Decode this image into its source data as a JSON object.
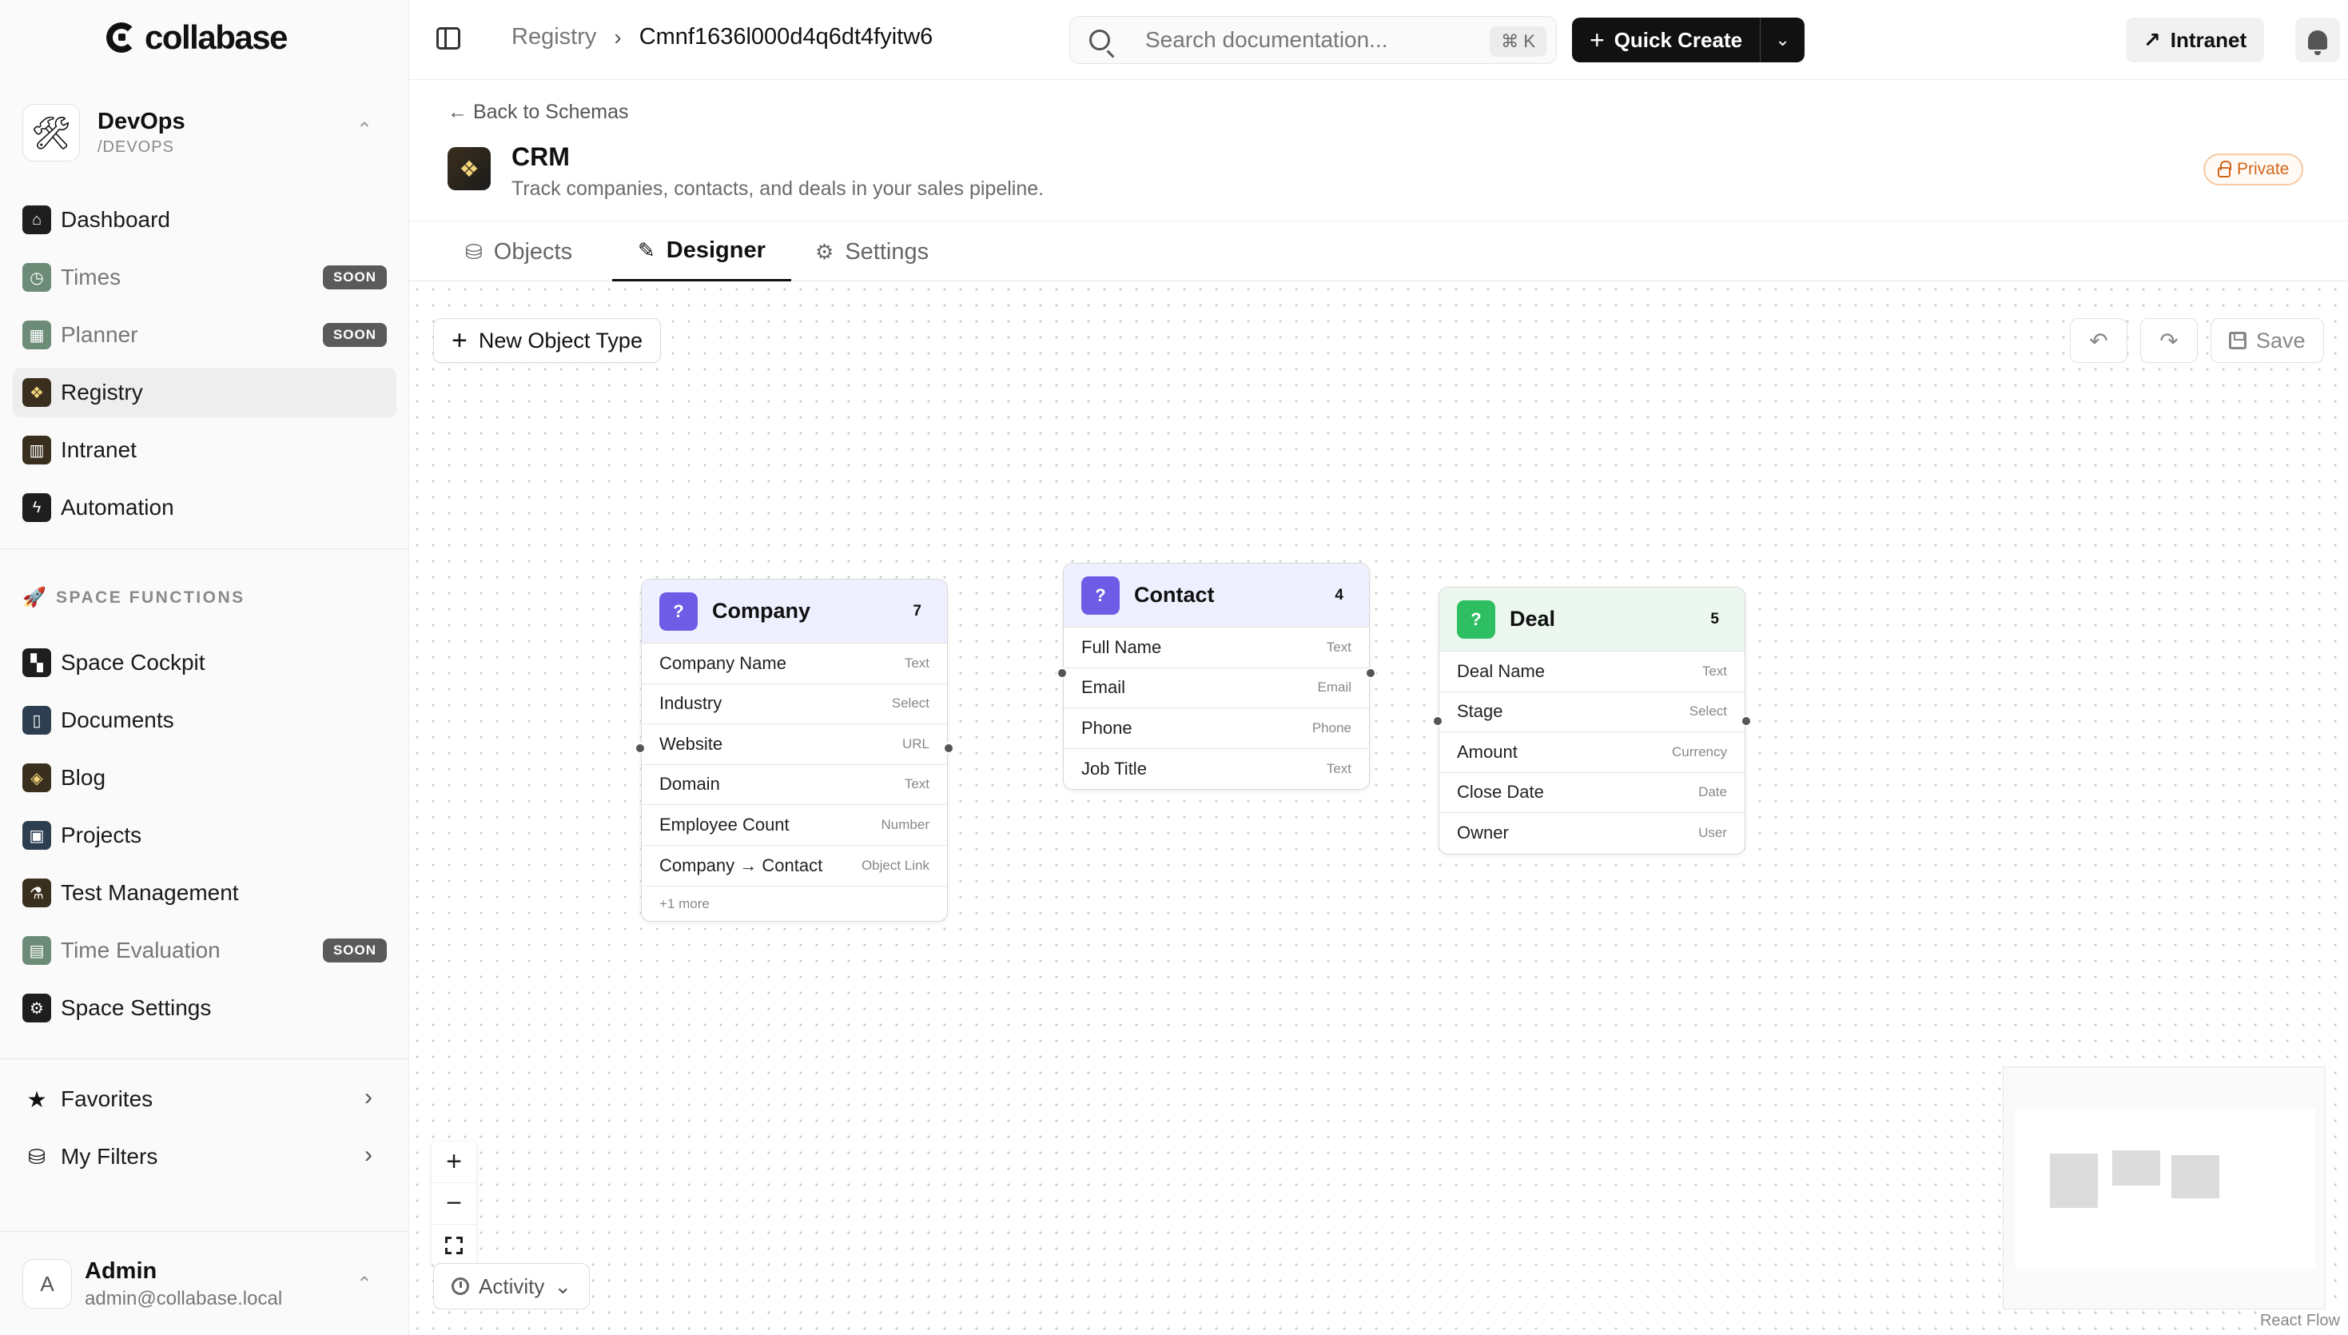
{
  "app": {
    "logo_text": "collabase"
  },
  "workspace": {
    "name": "DevOps",
    "slug": "/DEVOPS"
  },
  "sidebar": {
    "nav": [
      {
        "label": "Dashboard"
      },
      {
        "label": "Times",
        "badge": "SOON"
      },
      {
        "label": "Planner",
        "badge": "SOON"
      },
      {
        "label": "Registry"
      },
      {
        "label": "Intranet"
      },
      {
        "label": "Automation"
      }
    ],
    "section_label": "SPACE FUNCTIONS",
    "functions": [
      {
        "label": "Space Cockpit"
      },
      {
        "label": "Documents"
      },
      {
        "label": "Blog"
      },
      {
        "label": "Projects"
      },
      {
        "label": "Test Management"
      },
      {
        "label": "Time Evaluation",
        "badge": "SOON"
      },
      {
        "label": "Space Settings"
      }
    ],
    "favorites": "Favorites",
    "my_filters": "My Filters"
  },
  "user": {
    "initial": "A",
    "name": "Admin",
    "email": "admin@collabase.local"
  },
  "topbar": {
    "breadcrumb": [
      "Registry",
      "Cmnf1636l000d4q6dt4fyitw6"
    ],
    "search_placeholder": "Search documentation...",
    "search_shortcut": "⌘ K",
    "quick_create": "Quick Create",
    "intranet": "Intranet"
  },
  "header": {
    "back_link": "Back to Schemas",
    "title": "CRM",
    "description": "Track companies, contacts, and deals in your sales pipeline.",
    "visibility": "Private"
  },
  "tabs": [
    {
      "label": "Objects"
    },
    {
      "label": "Designer"
    },
    {
      "label": "Settings"
    }
  ],
  "toolbar": {
    "new_object_type": "New Object Type",
    "save": "Save"
  },
  "nodes": {
    "company": {
      "icon": "?",
      "name": "Company",
      "count": "7",
      "fields": [
        {
          "name": "Company Name",
          "type": "Text"
        },
        {
          "name": "Industry",
          "type": "Select"
        },
        {
          "name": "Website",
          "type": "URL"
        },
        {
          "name": "Domain",
          "type": "Text"
        },
        {
          "name": "Employee Count",
          "type": "Number"
        },
        {
          "name": "Company → Contact",
          "type": "Object Link"
        }
      ],
      "more": "+1 more"
    },
    "contact": {
      "icon": "?",
      "name": "Contact",
      "count": "4",
      "fields": [
        {
          "name": "Full Name",
          "type": "Text"
        },
        {
          "name": "Email",
          "type": "Email"
        },
        {
          "name": "Phone",
          "type": "Phone"
        },
        {
          "name": "Job Title",
          "type": "Text"
        }
      ]
    },
    "deal": {
      "icon": "?",
      "name": "Deal",
      "count": "5",
      "fields": [
        {
          "name": "Deal Name",
          "type": "Text"
        },
        {
          "name": "Stage",
          "type": "Select"
        },
        {
          "name": "Amount",
          "type": "Currency"
        },
        {
          "name": "Close Date",
          "type": "Date"
        },
        {
          "name": "Owner",
          "type": "User"
        }
      ]
    }
  },
  "activity": "Activity",
  "attribution": "React Flow",
  "colors": {
    "company_accent": "#6f5ce6",
    "contact_accent": "#6f5ce6",
    "deal_accent": "#2fbf63",
    "private_badge": "#d0661c"
  }
}
